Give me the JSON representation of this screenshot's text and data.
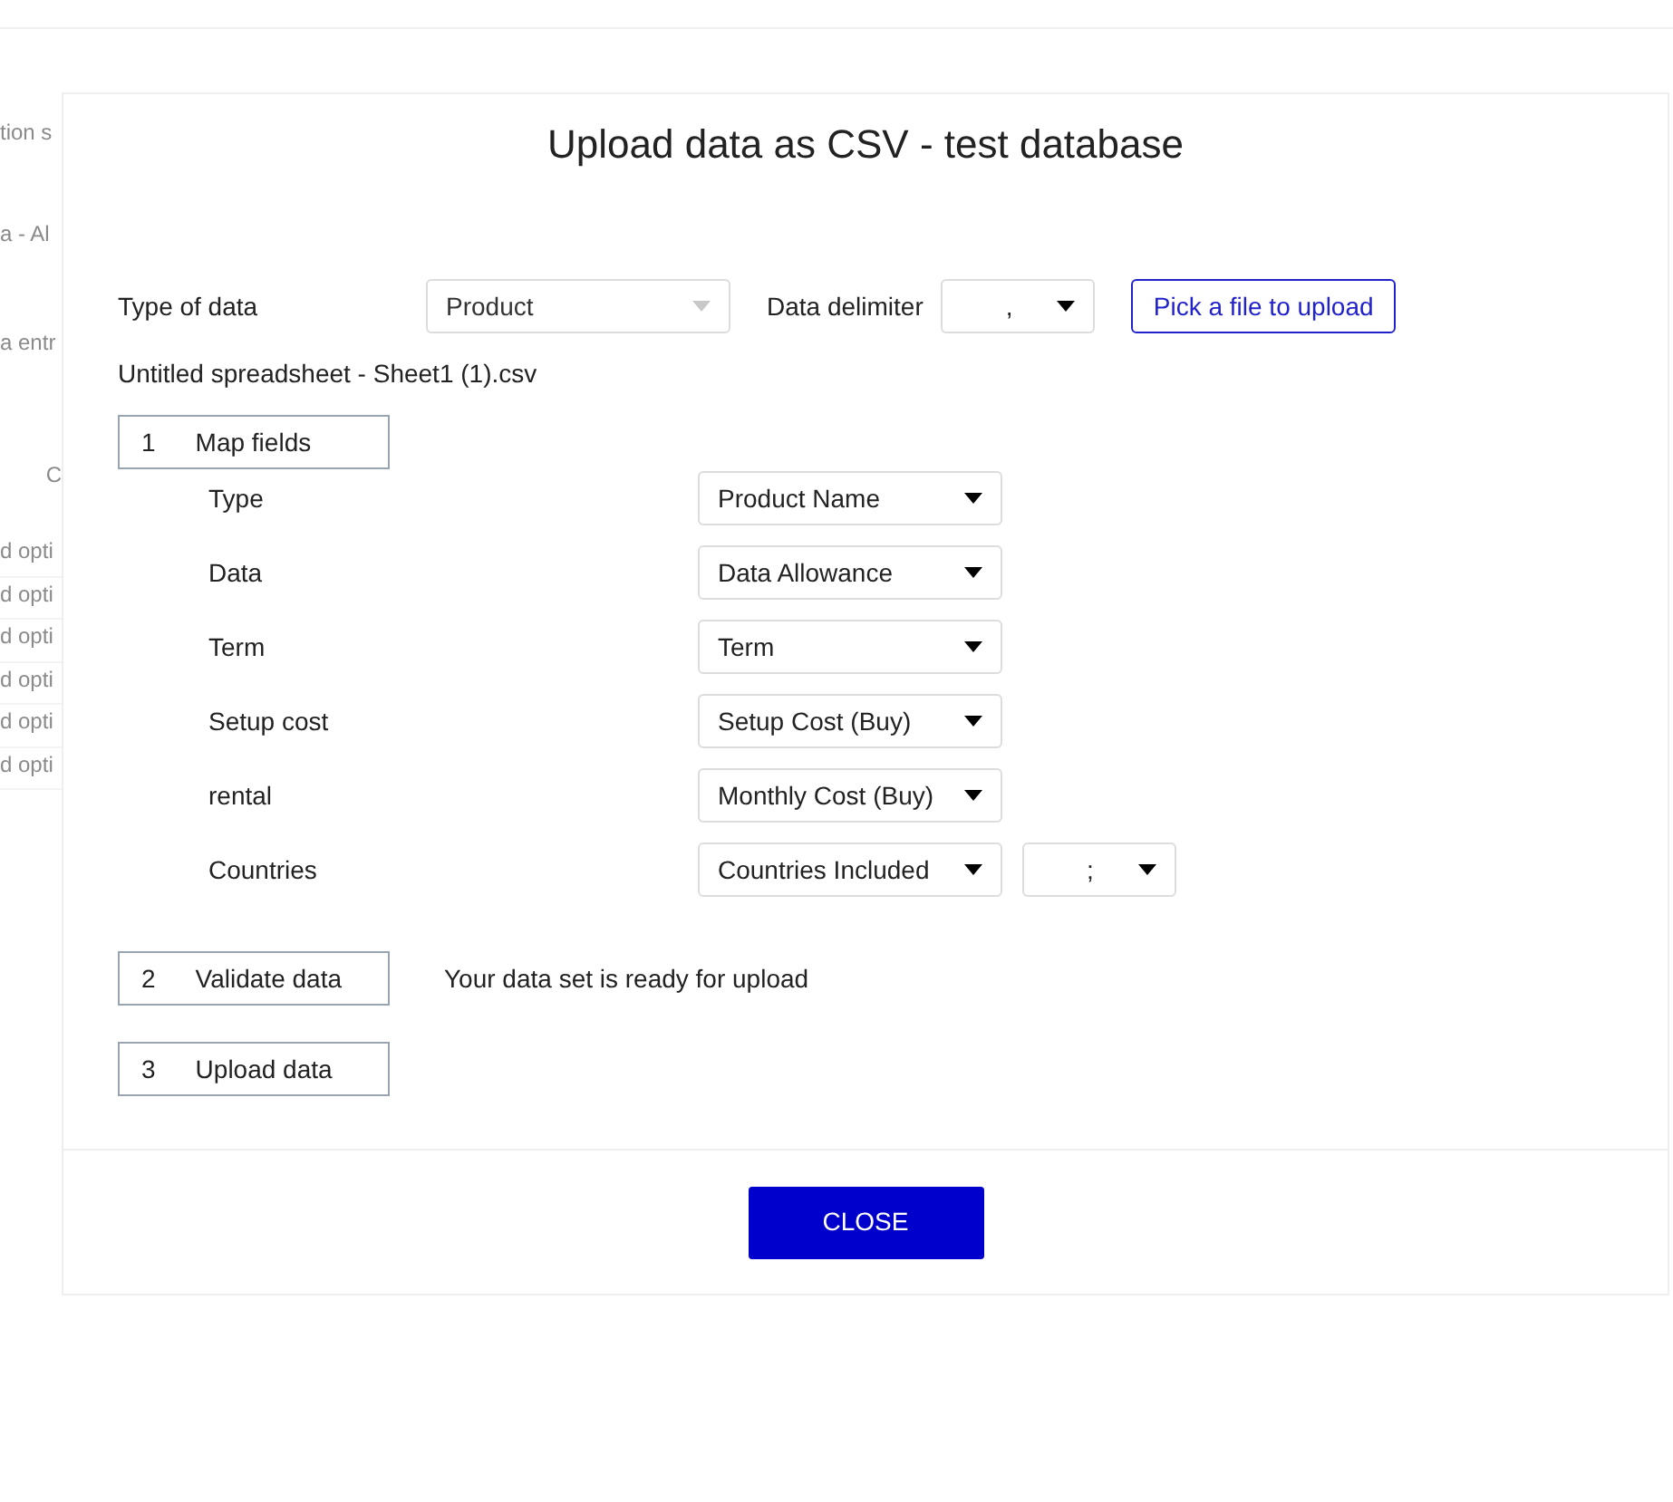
{
  "background": {
    "texts": [
      "tion s",
      "a - Al",
      "a entr"
    ],
    "table_header": "C",
    "table_rows": [
      "d opti",
      "d opti",
      "d opti",
      "d opti",
      "d opti",
      "d opti"
    ]
  },
  "dialog": {
    "title": "Upload data as CSV - test database",
    "type_of_data": {
      "label": "Type of data",
      "value": "Product",
      "disabled": true
    },
    "delimiter": {
      "label": "Data delimiter",
      "value": ","
    },
    "pick_button": "Pick a file to upload",
    "file_name": "Untitled spreadsheet - Sheet1 (1).csv",
    "steps": [
      {
        "number": "1",
        "label": "Map fields"
      },
      {
        "number": "2",
        "label": "Validate data"
      },
      {
        "number": "3",
        "label": "Upload data"
      }
    ],
    "mappings": [
      {
        "field": "Type",
        "column": "Product Name"
      },
      {
        "field": "Data",
        "column": "Data Allowance"
      },
      {
        "field": "Term",
        "column": "Term"
      },
      {
        "field": "Setup cost",
        "column": "Setup Cost (Buy)"
      },
      {
        "field": "rental",
        "column": "Monthly Cost (Buy)"
      },
      {
        "field": "Countries",
        "column": "Countries Included",
        "separator": ";"
      }
    ],
    "validation_message": "Your data set is ready for upload",
    "close_button": "CLOSE"
  }
}
